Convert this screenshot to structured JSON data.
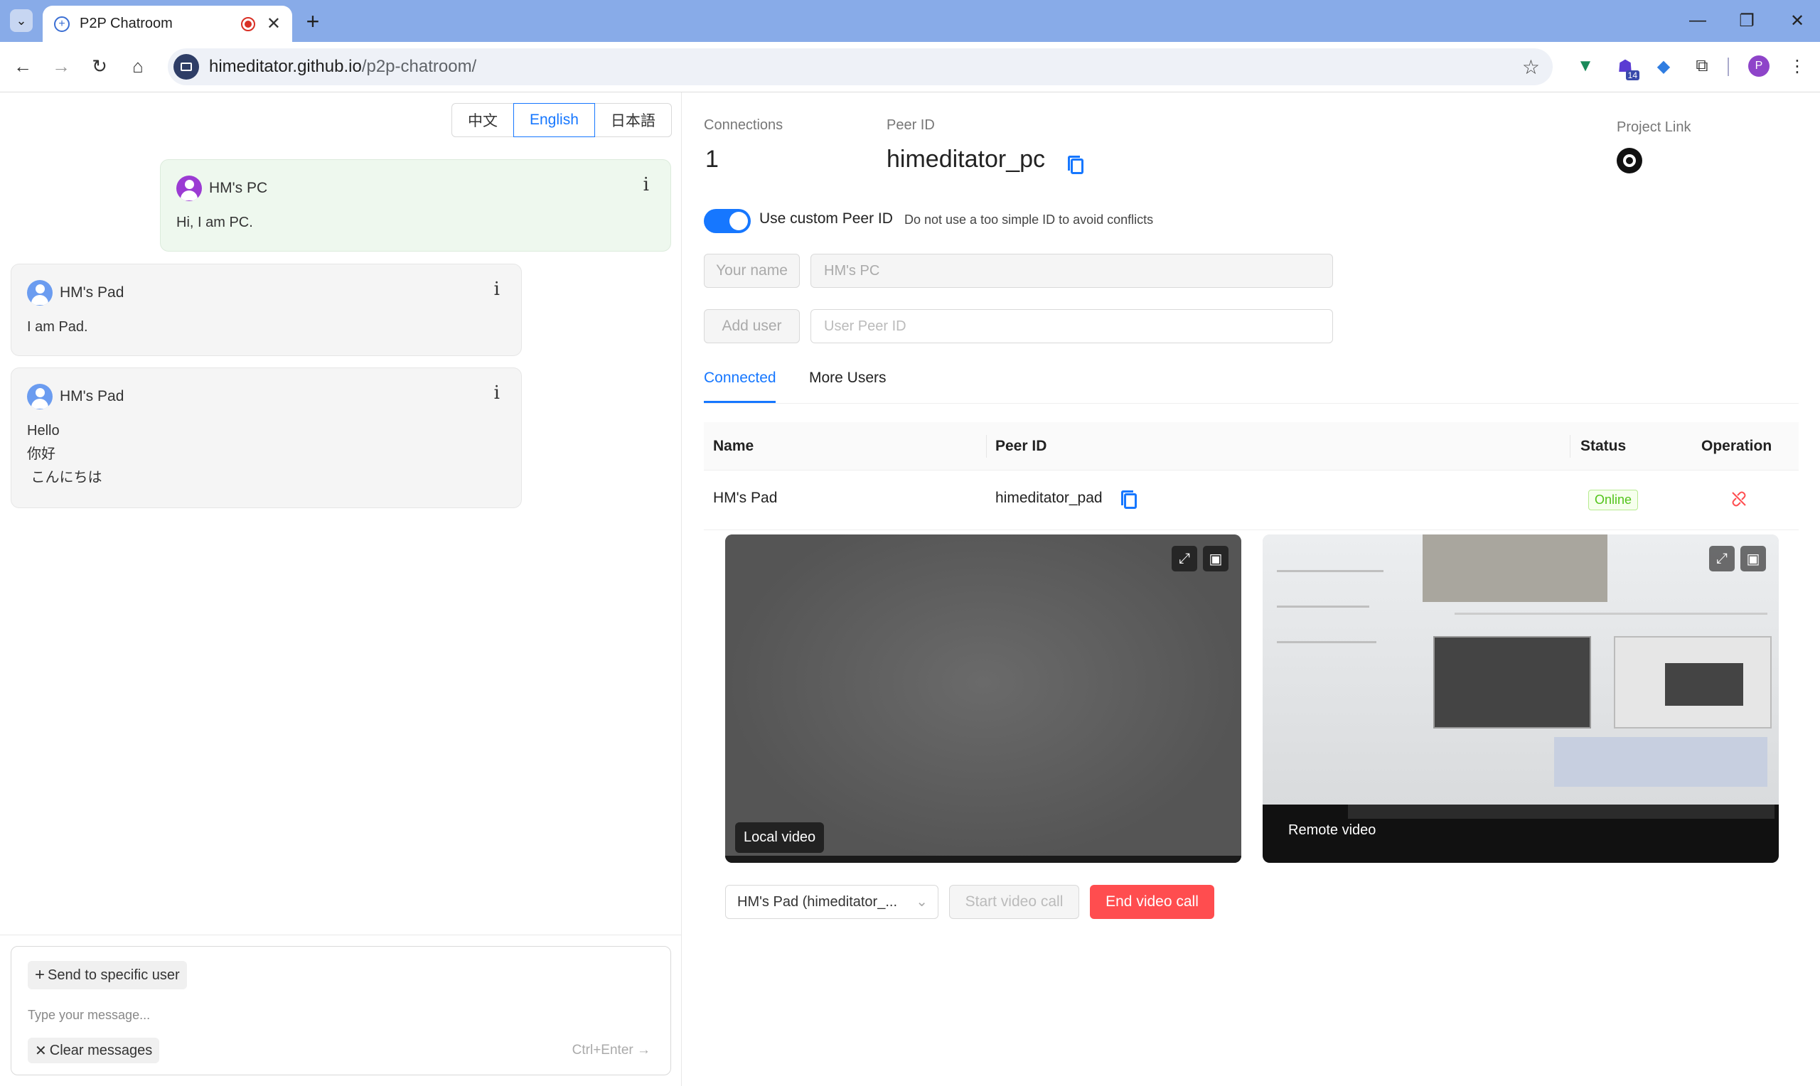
{
  "browser": {
    "tab_title": "P2P Chatroom",
    "url_host": "himeditator.github.io",
    "url_path": "/p2p-chatroom/",
    "ext_badge": "14",
    "profile_initial": "P"
  },
  "lang": {
    "options": [
      "中文",
      "English",
      "日本語"
    ],
    "active": "English"
  },
  "messages": [
    {
      "name": "HM's PC",
      "text": "Hi, I am PC.",
      "mine": true,
      "avatar_color": "#9b3bd3"
    },
    {
      "name": "HM's Pad",
      "text": "I am Pad.",
      "mine": false,
      "avatar_color": "#6b9cf0"
    },
    {
      "name": "HM's Pad",
      "lines": [
        "Hello",
        "你好",
        " こんにちは"
      ],
      "mine": false,
      "avatar_color": "#6b9cf0"
    }
  ],
  "composer": {
    "send_specific": "Send to specific user",
    "placeholder": "Type your message...",
    "clear": "Clear messages",
    "hint": "Ctrl+Enter"
  },
  "info": {
    "connections_label": "Connections",
    "connections_value": "1",
    "peer_id_label": "Peer ID",
    "peer_id_value": "himeditator_pc",
    "project_link_label": "Project Link",
    "toggle_label": "Use custom Peer ID",
    "toggle_hint": "Do not use a too simple ID to avoid conflicts",
    "toggle_on": true
  },
  "form": {
    "name_btn": "Your name",
    "name_value": "HM's PC",
    "add_btn": "Add user",
    "peer_placeholder": "User Peer ID"
  },
  "tabs": [
    "Connected",
    "More Users"
  ],
  "table": {
    "headers": [
      "Name",
      "Peer ID",
      "Status",
      "Operation"
    ],
    "rows": [
      {
        "name": "HM's Pad",
        "peer_id": "himeditator_pad",
        "status": "Online"
      }
    ]
  },
  "video": {
    "local_label": "Local video",
    "remote_label": "Remote video",
    "select_value": "HM's Pad (himeditator_...",
    "start_btn": "Start video call",
    "end_btn": "End video call"
  },
  "colors": {
    "accent": "#1677ff",
    "danger": "#ff4d4f",
    "online": "#52c41a",
    "chrome_frame": "#88abe8"
  }
}
